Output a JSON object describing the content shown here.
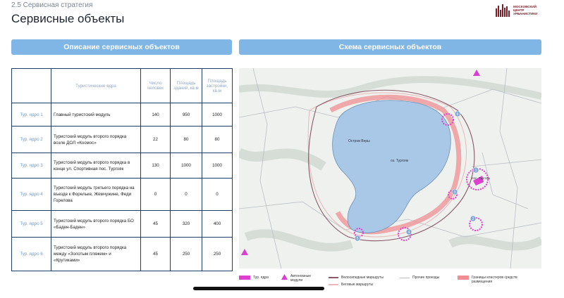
{
  "breadcrumb": "2.5 Сервисная стратегия",
  "page_title": "Сервисные объекты",
  "logo": {
    "lines": [
      "МОСКОВСКИЙ",
      "ЦЕНТР",
      "УРБАНИСТИКИ"
    ],
    "color": "#7a1e2a"
  },
  "left_panel": {
    "title": "Описание сервисных объектов"
  },
  "right_panel": {
    "title": "Схема сервисных объектов"
  },
  "table": {
    "headers": [
      "",
      "Туристические ядра",
      "Число человек",
      "Площадь зданий, кв.м",
      "Площадь застройки, кв.м"
    ],
    "rows": [
      {
        "core": "Тур. ядро 1",
        "desc": "Главный туристский модуль",
        "people": "140",
        "area": "950",
        "built": "1000"
      },
      {
        "core": "Тур. ядро 2",
        "desc": "Туристский модуль второго порядка возле ДОЛ «Космос»",
        "people": "22",
        "area": "80",
        "built": "80"
      },
      {
        "core": "Тур. ядро 3",
        "desc": "Туристский модуль второго порядка в конце ул. Спортивная пос. Тургояк",
        "people": "130",
        "area": "1000",
        "built": "1000"
      },
      {
        "core": "Тур. ядро 4",
        "desc": "Туристский модуль третьего порядка на въезде к Форельке, Жемчужине, Феди Горелова",
        "people": "0",
        "area": "0",
        "built": "0"
      },
      {
        "core": "Тур. ядро 5",
        "desc": "Туристский модуль второго порядка БО «Баден-Баден»",
        "people": "45",
        "area": "320",
        "built": "400"
      },
      {
        "core": "Тур. ядро 6",
        "desc": "Туристский модуль второго порядка между «Золотым пляжем» и «Крутиками»",
        "people": "45",
        "area": "250",
        "built": "250"
      }
    ]
  },
  "map": {
    "lake_label": "оз. Тургояк",
    "island_label": "Остров Веры",
    "settlement_label": "пос. Тургояк",
    "markers": [
      "1",
      "2",
      "3",
      "4",
      "5",
      "6"
    ],
    "colors": {
      "lake": "#a9c8e8",
      "core": "#e040d0",
      "route": "#e58f95"
    }
  },
  "legend": {
    "core": "Тур. ядра",
    "auto": "Автономные модули",
    "bike": "Велосипедные маршруты",
    "run": "Беговые маршруты",
    "other": "Прочие проезды",
    "clusters": "Границы кластеров средств размещения"
  }
}
